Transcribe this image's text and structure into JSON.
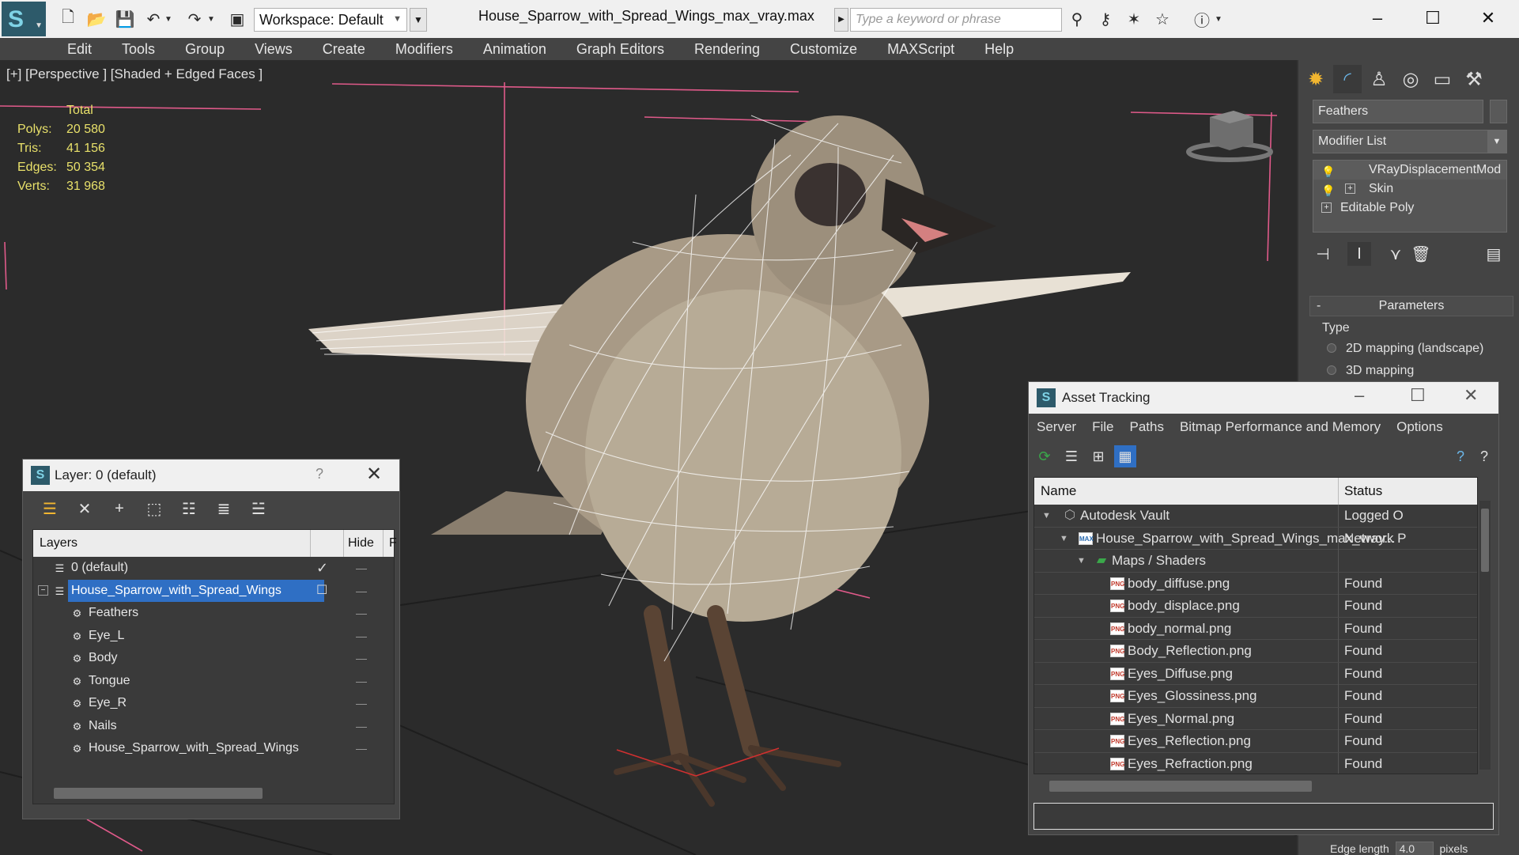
{
  "titlebar": {
    "workspace": "Workspace: Default",
    "file_title": "House_Sparrow_with_Spread_Wings_max_vray.max",
    "search_placeholder": "Type a keyword or phrase"
  },
  "menu": [
    "Edit",
    "Tools",
    "Group",
    "Views",
    "Create",
    "Modifiers",
    "Animation",
    "Graph Editors",
    "Rendering",
    "Customize",
    "MAXScript",
    "Help"
  ],
  "viewport": {
    "label": "[+] [Perspective ] [Shaded + Edged Faces ]",
    "stats_total": "Total",
    "stats": [
      {
        "k": "Polys:",
        "v": "20 580"
      },
      {
        "k": "Tris:",
        "v": "41 156"
      },
      {
        "k": "Edges:",
        "v": "50 354"
      },
      {
        "k": "Verts:",
        "v": "31 968"
      }
    ]
  },
  "command_panel": {
    "object_name": "Feathers",
    "modifier_list": "Modifier List",
    "stack": [
      "VRayDisplacementMod",
      "Skin",
      "Editable Poly"
    ],
    "params_title": "Parameters",
    "type_label": "Type",
    "radio_2d": "2D mapping (landscape)",
    "radio_3d": "3D mapping",
    "edge_length_label": "Edge length",
    "edge_length_value": "4.0",
    "edge_length_unit": "pixels"
  },
  "layer_panel": {
    "title": "Layer: 0 (default)",
    "help": "?",
    "col_layers": "Layers",
    "col_hide": "Hide",
    "col_f": "F",
    "rows": [
      {
        "label": "0 (default)"
      },
      {
        "label": "House_Sparrow_with_Spread_Wings"
      },
      {
        "label": "Feathers"
      },
      {
        "label": "Eye_L"
      },
      {
        "label": "Body"
      },
      {
        "label": "Tongue"
      },
      {
        "label": "Eye_R"
      },
      {
        "label": "Nails"
      },
      {
        "label": "House_Sparrow_with_Spread_Wings"
      }
    ]
  },
  "asset_panel": {
    "title": "Asset Tracking",
    "menu": [
      "Server",
      "File",
      "Paths",
      "Bitmap Performance and Memory",
      "Options"
    ],
    "col_name": "Name",
    "col_status": "Status",
    "rows": [
      {
        "name": "Autodesk Vault",
        "status": "Logged O",
        "icon": "vault-icon"
      },
      {
        "name": "House_Sparrow_with_Spread_Wings_max_vray...",
        "status": "Network P",
        "icon": "max-file-icon"
      },
      {
        "name": "Maps / Shaders",
        "status": "",
        "icon": "maps-folder-icon"
      },
      {
        "name": "body_diffuse.png",
        "status": "Found",
        "icon": "png-icon"
      },
      {
        "name": "body_displace.png",
        "status": "Found",
        "icon": "png-icon"
      },
      {
        "name": "body_normal.png",
        "status": "Found",
        "icon": "png-icon"
      },
      {
        "name": "Body_Reflection.png",
        "status": "Found",
        "icon": "png-icon"
      },
      {
        "name": "Eyes_Diffuse.png",
        "status": "Found",
        "icon": "png-icon"
      },
      {
        "name": "Eyes_Glossiness.png",
        "status": "Found",
        "icon": "png-icon"
      },
      {
        "name": "Eyes_Normal.png",
        "status": "Found",
        "icon": "png-icon"
      },
      {
        "name": "Eyes_Reflection.png",
        "status": "Found",
        "icon": "png-icon"
      },
      {
        "name": "Eyes_Refraction.png",
        "status": "Found",
        "icon": "png-icon"
      }
    ]
  },
  "colors": {
    "stats_yellow": "#e8e06a",
    "selection_blue": "#2f6fc4",
    "gizmo_pink": "#e05a8a"
  }
}
